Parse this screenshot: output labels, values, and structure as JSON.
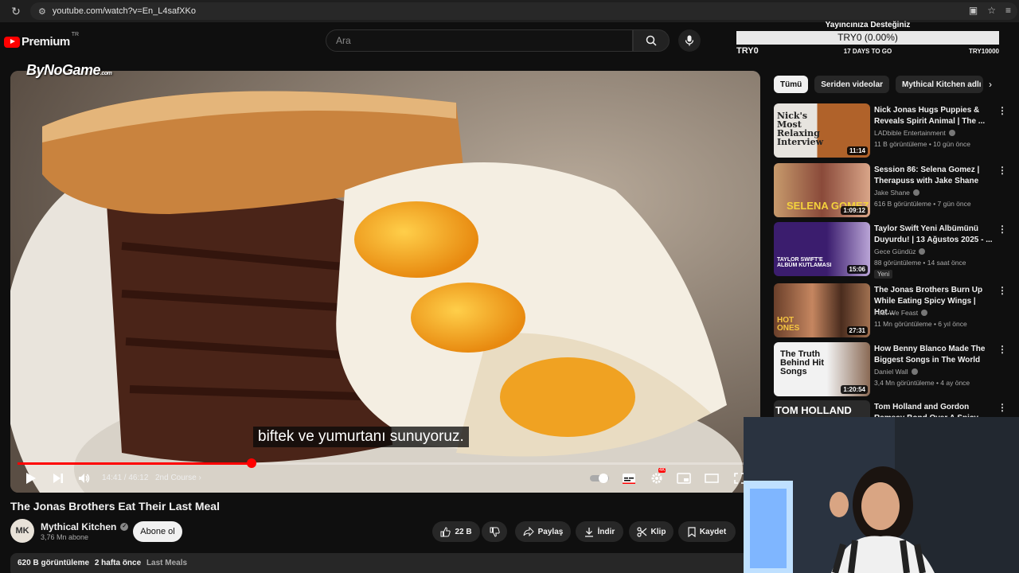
{
  "browser": {
    "url": "youtube.com/watch?v=En_L4safXKo",
    "reload_icon": "reload-icon",
    "site_settings_icon": "tune-icon",
    "icons": [
      "cast-icon",
      "star-icon",
      "reading-list-icon"
    ]
  },
  "header": {
    "logo_text": "Premium",
    "logo_region": "TR",
    "search_placeholder": "Ara"
  },
  "overlay": {
    "donation_title": "Yayıncınıza Desteğiniz",
    "donation_amount": "TRY0 (0.00%)",
    "donation_progress": 0.0,
    "donation_left": "TRY0",
    "donation_days": "17 DAYS TO GO",
    "donation_right": "TRY10000",
    "watermark_text": "ByNoGame",
    "watermark_suffix": ".com"
  },
  "player": {
    "subtitle": "biftek ve yumurtanı sunuyoruz.",
    "current_time": "14:41",
    "duration": "46:12",
    "time_display": "14:41 / 46:12",
    "chapter": "2nd Course",
    "progress_fraction": 0.3178,
    "quality_badge": "4K"
  },
  "video": {
    "title": "The Jonas Brothers Eat Their Last Meal",
    "channel": "Mythical Kitchen",
    "subscribers": "3,76 Mn abone",
    "subscribe_label": "Abone ol",
    "likes": "22 B",
    "share_label": "Paylaş",
    "download_label": "İndir",
    "clip_label": "Klip",
    "save_label": "Kaydet",
    "views": "620 B görüntüleme",
    "age": "2 hafta önce",
    "tag": "Last Meals"
  },
  "chips": [
    "Tümü",
    "Seriden videolar",
    "Mythical Kitchen adlı"
  ],
  "recommendations": [
    {
      "title": "Nick Jonas Hugs Puppies & Reveals Spirit Animal | The ...",
      "channel": "LADbible Entertainment",
      "meta": "11 B görüntüleme • 10 gün önce",
      "duration": "11:14",
      "thumb_text": "Nick's Most Relaxing Interview"
    },
    {
      "title": "Session 86: Selena Gomez | Therapuss with Jake Shane",
      "channel": "Jake Shane",
      "meta": "616 B görüntüleme • 7 gün önce",
      "duration": "1:09:12",
      "thumb_text": "SELENA GOMEZ"
    },
    {
      "title": "Taylor Swift Yeni Albümünü Duyurdu! | 13 Ağustos 2025 - ...",
      "channel": "Gece Gündüz",
      "meta": "88 görüntüleme • 14 saat önce",
      "badge": "Yeni",
      "duration": "15:06",
      "thumb_text": "TAYLOR SWIFT'E ALBÜM KUTLAMASI"
    },
    {
      "title": "The Jonas Brothers Burn Up While Eating Spicy Wings | Hot...",
      "channel": "First We Feast",
      "meta": "11 Mn görüntüleme • 6 yıl önce",
      "duration": "27:31",
      "thumb_text": "HOT ONES"
    },
    {
      "title": "How Benny Blanco Made The Biggest Songs in The World",
      "channel": "Daniel Wall",
      "meta": "3,4 Mn görüntüleme • 4 ay önce",
      "duration": "1:20:54",
      "thumb_text": "The Truth Behind Hit Songs"
    },
    {
      "title": "Tom Holland and Gordon Ramsay Bond Over A Spicy...",
      "channel": "",
      "meta": "",
      "duration": "",
      "thumb_text": "TOM HOLLAND"
    }
  ],
  "colors": {
    "background": "#0f0f0f",
    "accent": "#ff0000",
    "chip_bg": "#272727",
    "chip_active_bg": "#f1f1f1",
    "secondary_text": "#aaaaaa"
  }
}
